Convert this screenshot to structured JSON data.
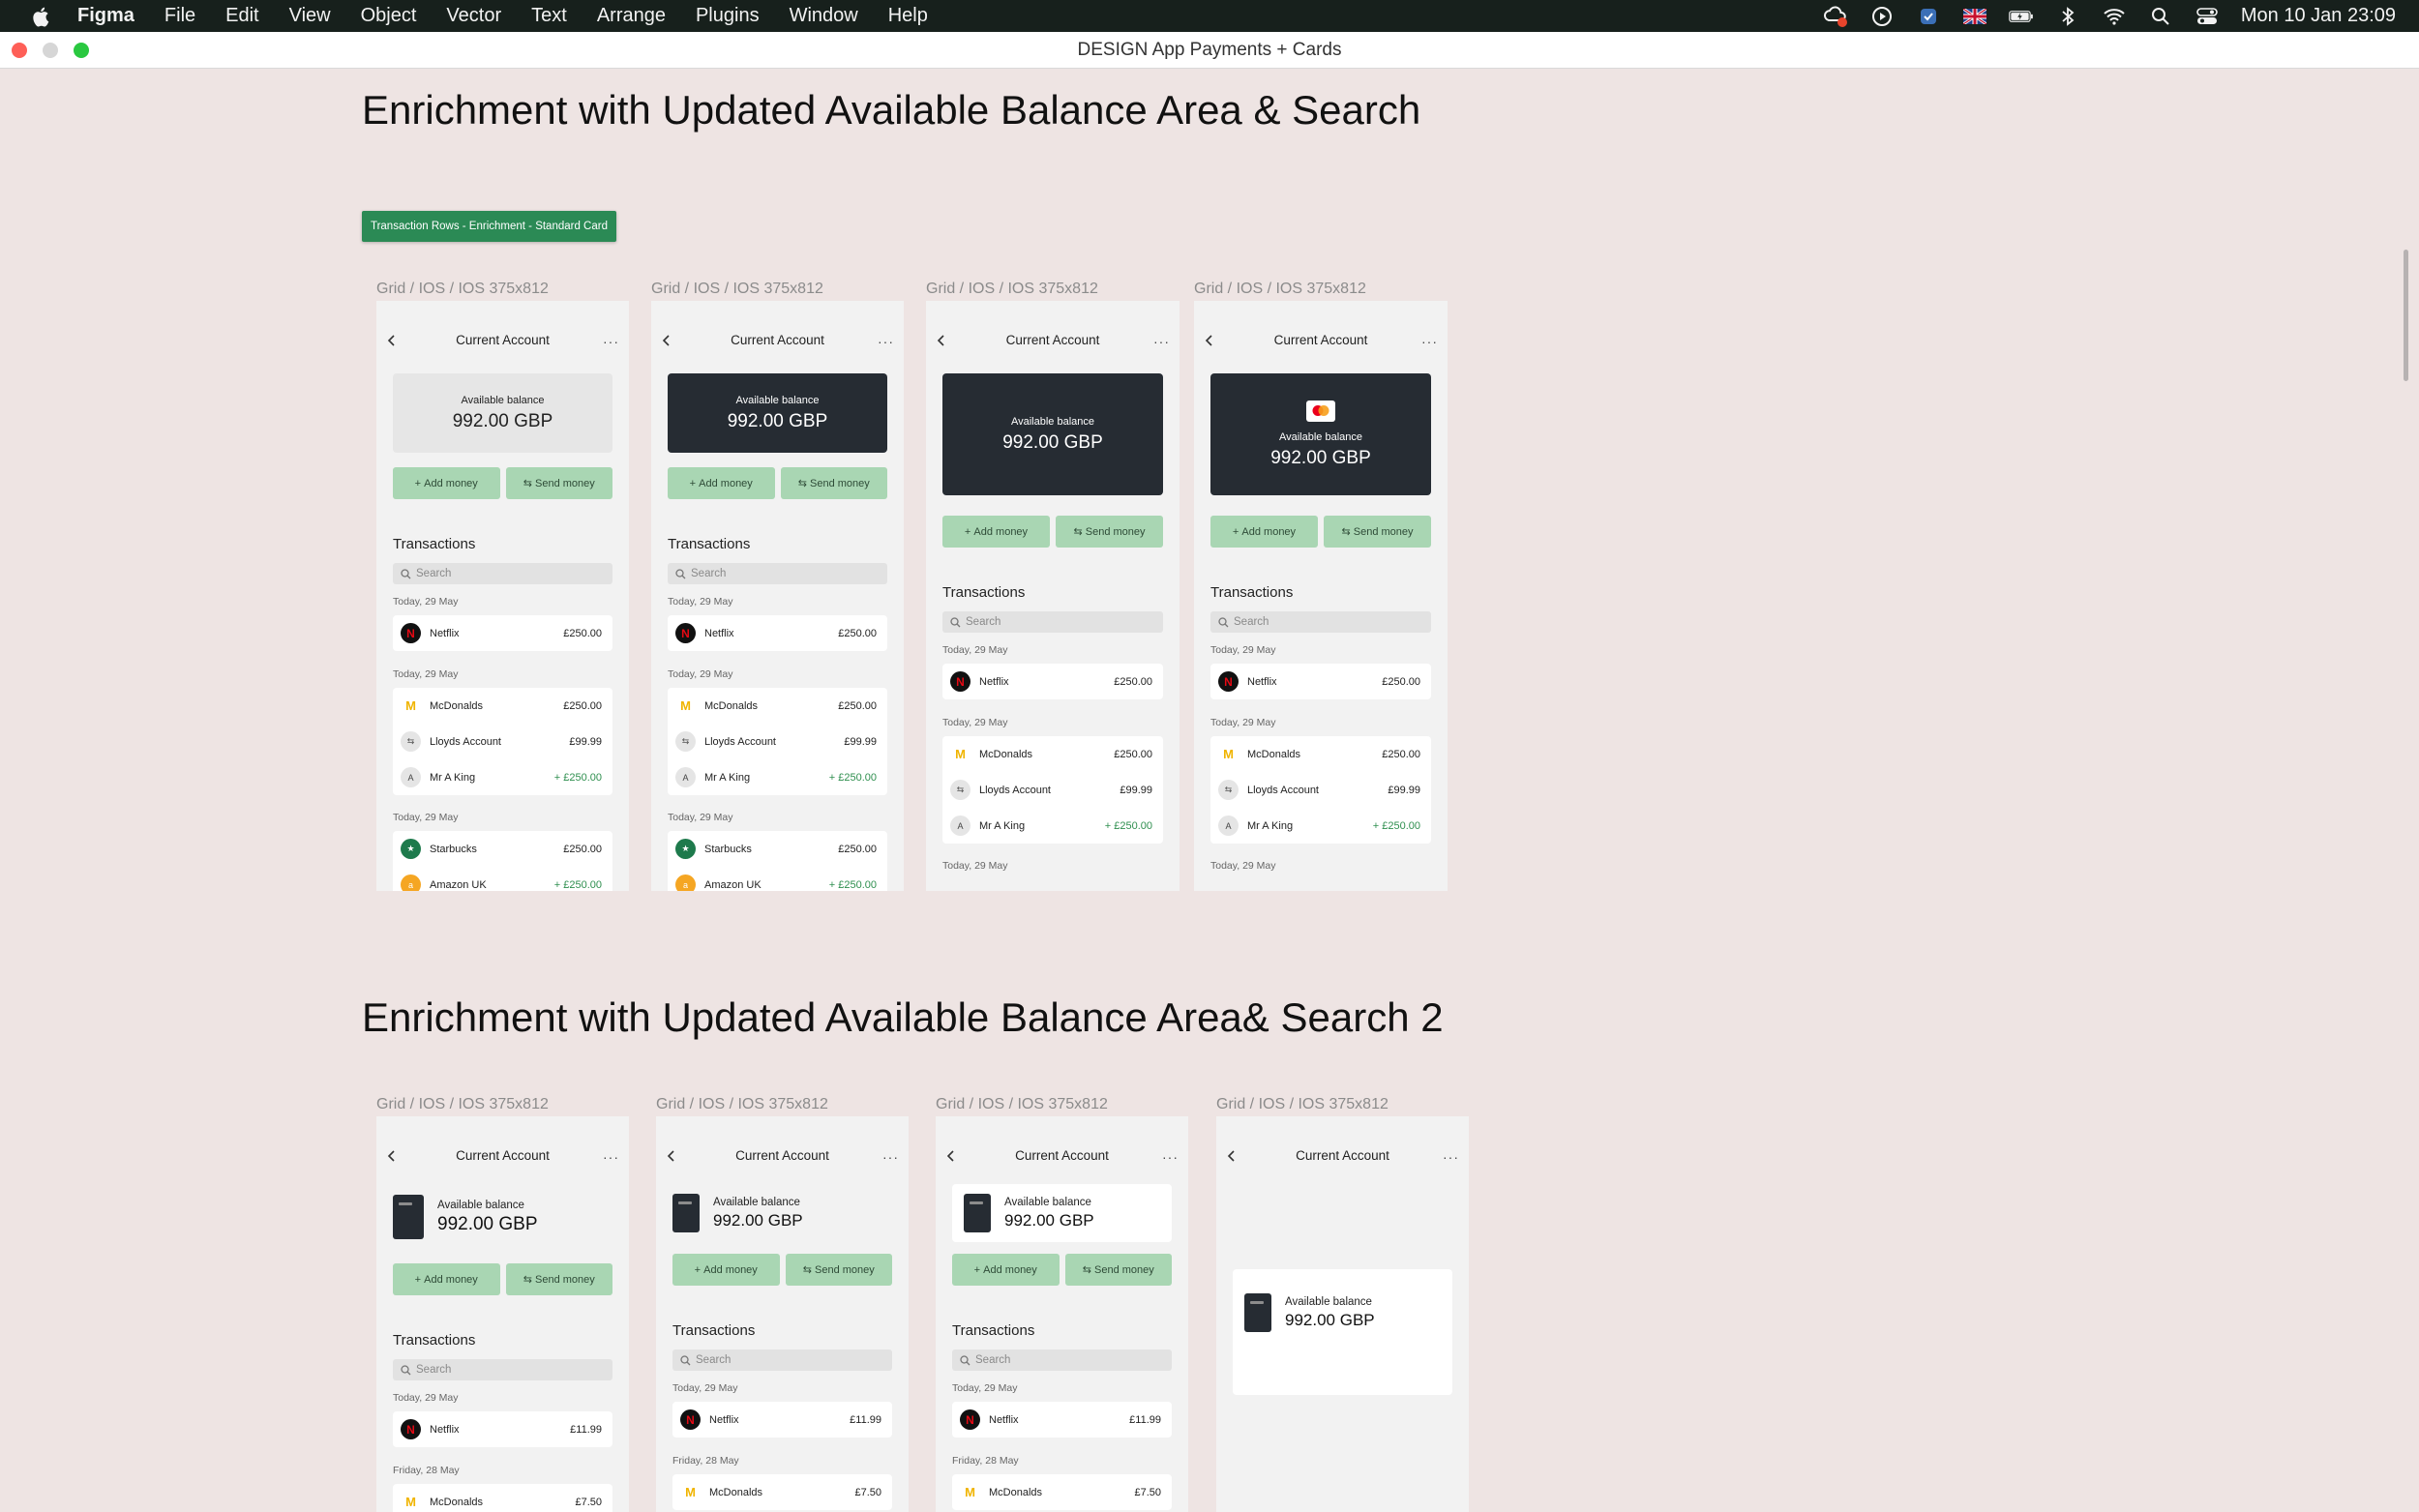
{
  "menubar": {
    "app": "Figma",
    "items": [
      "File",
      "Edit",
      "View",
      "Object",
      "Vector",
      "Text",
      "Arrange",
      "Plugins",
      "Window",
      "Help"
    ],
    "datetime": "Mon 10 Jan  23:09"
  },
  "window": {
    "title": "DESIGN App Payments + Cards"
  },
  "section1": {
    "heading": "Enrichment with Updated Available Balance Area & Search",
    "tag": "Transaction Rows - Enrichment - Standard Card"
  },
  "section2": {
    "heading": "Enrichment with Updated Available Balance Area& Search 2"
  },
  "frame": {
    "label": "Grid / IOS / IOS 375x812",
    "title": "Current Account",
    "more": "···",
    "balance_label": "Available balance",
    "balance_value": "992.00 GBP",
    "add_money": "Add money",
    "send_money": "Send money",
    "send": "Send",
    "transactions": "Transactions",
    "search_placeholder": "Search",
    "date_today": "Today, 29 May",
    "date_friday": "Friday, 28 May"
  },
  "txA": {
    "netflix": {
      "name": "Netflix",
      "amount": "£250.00"
    },
    "mcdonalds": {
      "name": "McDonalds",
      "amount": "£250.00"
    },
    "lloyds": {
      "name": "Lloyds Account",
      "amount": "£99.99"
    },
    "king": {
      "name": "Mr A King",
      "amount": "+ £250.00"
    },
    "starbucks": {
      "name": "Starbucks",
      "amount": "£250.00"
    },
    "amazon": {
      "name": "Amazon UK",
      "amount": "+ £250.00"
    }
  },
  "txB": {
    "netflix": {
      "name": "Netflix",
      "amount": "£11.99"
    },
    "mcdonalds": {
      "name": "McDonalds",
      "amount": "£7.50"
    }
  },
  "colors": {
    "canvas": "#eee4e3",
    "menubar": "#17201c",
    "accent_green": "#2b8a55",
    "button_green": "#a9d6b3",
    "dark_card": "#262c33",
    "positive_amount": "#2f8f4f"
  }
}
